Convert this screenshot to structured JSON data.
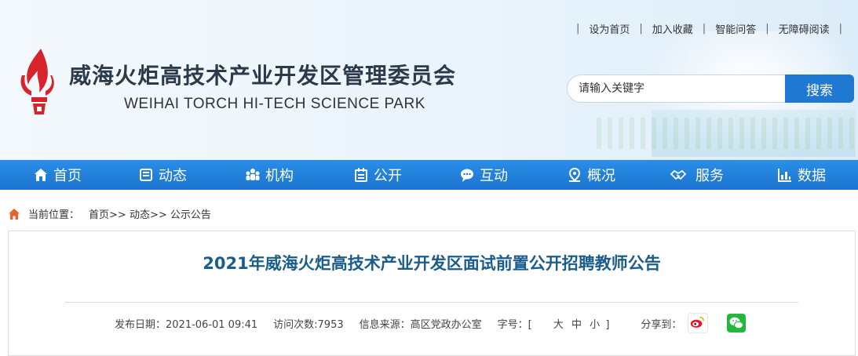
{
  "toplinks": {
    "set_home": "设为首页",
    "favorite": "加入收藏",
    "qa": "智能问答",
    "accessible": "无障碍阅读"
  },
  "site": {
    "name_cn": "威海火炬高技术产业开发区管理委员会",
    "name_en": "WEIHAI TORCH HI-TECH SCIENCE PARK"
  },
  "search": {
    "placeholder": "请输入关键字",
    "button": "搜索"
  },
  "nav": [
    {
      "label": "首页",
      "icon": "home-icon"
    },
    {
      "label": "动态",
      "icon": "news-icon"
    },
    {
      "label": "机构",
      "icon": "org-icon"
    },
    {
      "label": "公开",
      "icon": "calendar-icon"
    },
    {
      "label": "互动",
      "icon": "chat-icon"
    },
    {
      "label": "概况",
      "icon": "location-icon"
    },
    {
      "label": "服务",
      "icon": "handshake-icon"
    },
    {
      "label": "数据",
      "icon": "bar-chart-icon"
    }
  ],
  "breadcrumb": {
    "prefix": "当前位置：",
    "items": [
      "首页",
      "动态",
      "公示公告"
    ],
    "sep": ">>"
  },
  "article": {
    "title": "2021年威海火炬高技术产业开发区面试前置公开招聘教师公告",
    "date_label": "发布日期：2021-06-01 09:41",
    "views_label": "访问次数:7953",
    "source_label": "信息来源：高区党政办公室",
    "size_prefix": "字号：[",
    "size_large": "大",
    "size_medium": "中",
    "size_small": "小",
    "size_suffix": "]",
    "share_label": "分享到："
  },
  "colors": {
    "nav_bg": "#1f78d1",
    "title": "#1a5c8a",
    "logo_red": "#d7242a"
  }
}
